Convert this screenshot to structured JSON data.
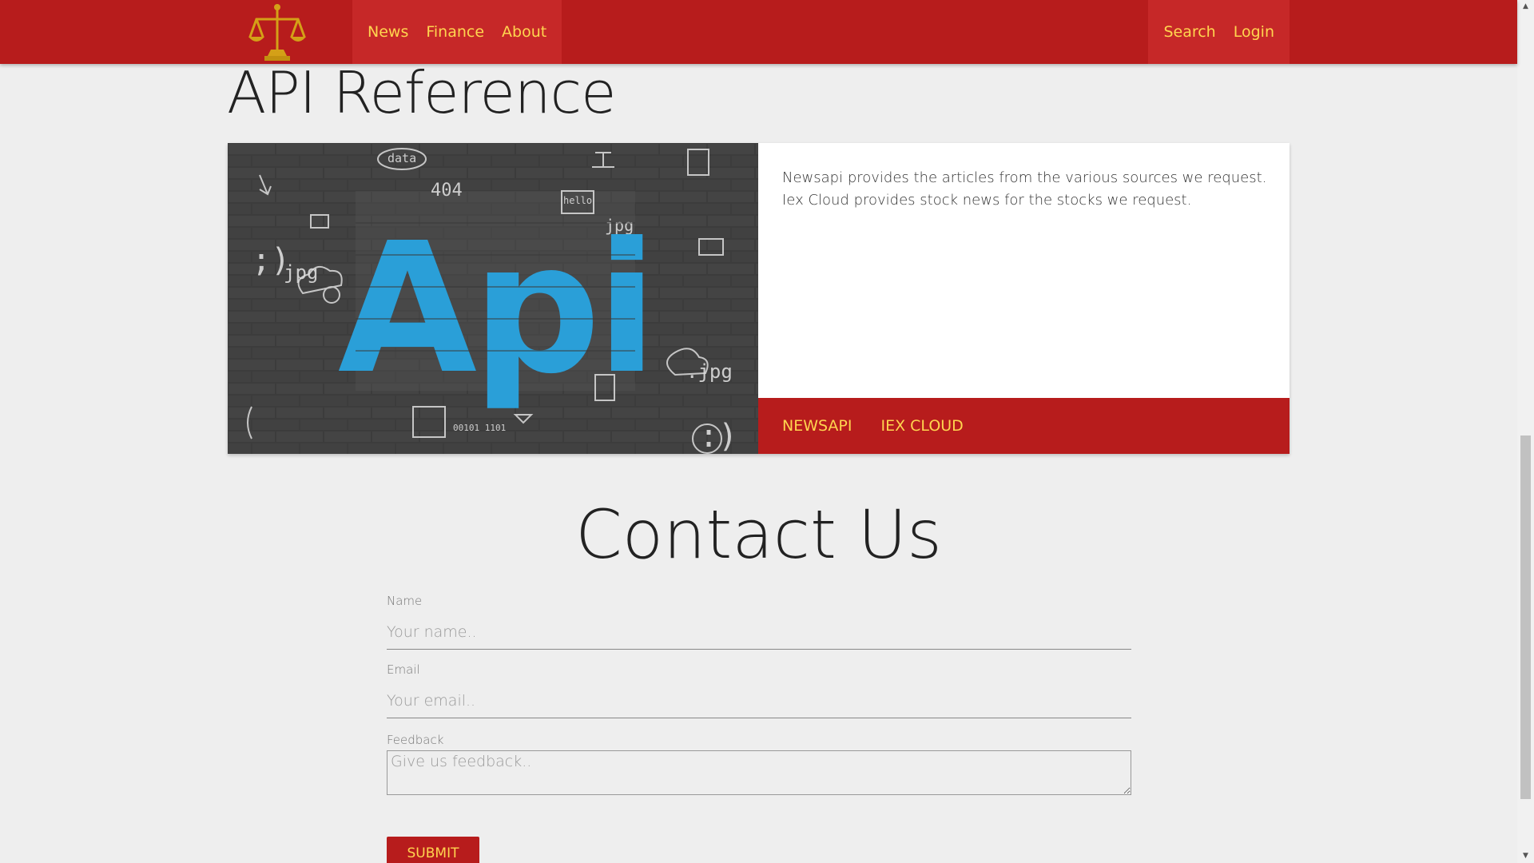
{
  "nav": {
    "left_links": [
      "News",
      "Finance",
      "About"
    ],
    "right_links": [
      "Search",
      "Login"
    ],
    "logo_icon": "scales-of-justice-icon"
  },
  "api_section": {
    "title": "API Reference",
    "image_text": "Api",
    "image_labels": [
      "data",
      "404",
      "jpg",
      ".jpg",
      "jpg",
      "hello",
      "00101 1101"
    ],
    "description_lines": [
      "Newsapi provides the articles from the various sources we request.",
      "Iex Cloud provides stock news for the stocks we request."
    ],
    "actions": [
      "NEWSAPI",
      "IEX CLOUD"
    ]
  },
  "contact": {
    "title": "Contact Us",
    "name_label": "Name",
    "name_placeholder": "Your name..",
    "email_label": "Email",
    "email_placeholder": "Your email..",
    "feedback_label": "Feedback",
    "feedback_placeholder": "Give us feedback..",
    "submit_label": "SUBMIT"
  },
  "colors": {
    "brand_red": "#b71c1c",
    "nav_highlight": "#c62828",
    "link_yellow": "#ffd54f",
    "api_blue": "#2a9fd8"
  }
}
